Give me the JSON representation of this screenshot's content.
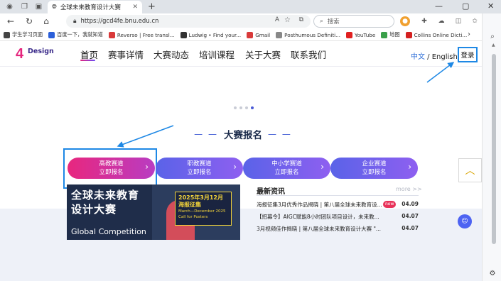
{
  "browser": {
    "tab_title": "全球未来教育设计大赛",
    "url": "https://gcd4fe.bnu.edu.cn",
    "search_placeholder": "搜索",
    "bookmarks": [
      {
        "label": "学生学习页面",
        "color": "#444444"
      },
      {
        "label": "百度一下，我就知道",
        "color": "#2b5fd9"
      },
      {
        "label": "Reverso | Free transl...",
        "color": "#d93a3a"
      },
      {
        "label": "Ludwig • Find your...",
        "color": "#333333"
      },
      {
        "label": "Gmail",
        "color": "#d93a3a"
      },
      {
        "label": "Posthumous Definiti...",
        "color": "#888888"
      },
      {
        "label": "YouTube",
        "color": "#e02020"
      },
      {
        "label": "地图",
        "color": "#3aa04a"
      },
      {
        "label": "Collins Online Dicti...",
        "color": "#d42020"
      }
    ]
  },
  "site": {
    "logo_text": "Design",
    "nav": [
      "首页",
      "赛事详情",
      "大赛动态",
      "培训课程",
      "关于大赛",
      "联系我们"
    ],
    "lang_zh": "中文",
    "lang_sep": " / ",
    "lang_en": "English",
    "login": "登录",
    "section_title": "大赛报名",
    "section_dash": "— —",
    "tracks": [
      {
        "name": "高教赛道",
        "action": "立即报名"
      },
      {
        "name": "职教赛道",
        "action": "立即报名"
      },
      {
        "name": "中小学赛道",
        "action": "立即报名"
      },
      {
        "name": "企业赛道",
        "action": "立即报名"
      }
    ],
    "poster": {
      "title_1": "全球未来教育",
      "title_2": "设计大赛",
      "subtitle": "Global Competition",
      "box_1": "2025年3月12月",
      "box_2": "海报征集",
      "box_3": "March—December 2025",
      "box_4": "Call for Posters"
    },
    "news": {
      "heading": "最新资讯",
      "more": "more >>",
      "items": [
        {
          "title": "海报征集3月优秀作品揭晓 | 第八届全球未来教育设...",
          "badge": "new",
          "date": "04.09"
        },
        {
          "title": "【招募令】AIGC赋能8小时团队项目设计，未来教...",
          "badge": "",
          "date": "04.07"
        },
        {
          "title": "3月视频佳作揭晓 | 第八届全球未来教育设计大赛 \"...",
          "badge": "",
          "date": "04.07"
        }
      ]
    },
    "colors": {
      "primary": "#e5267e",
      "secondary": "#6a4cf5",
      "annotation": "#1e88e5"
    }
  }
}
